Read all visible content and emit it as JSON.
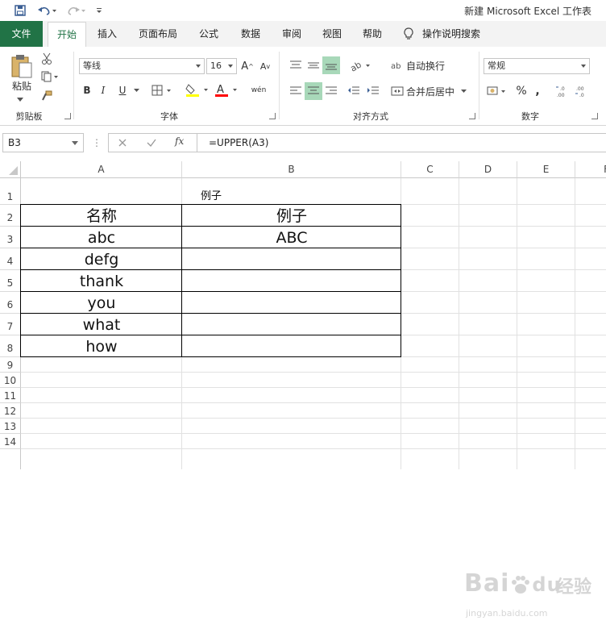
{
  "titlebar": {
    "title": "新建 Microsoft Excel 工作表",
    "save_icon": "save-icon",
    "undo_icon": "undo-icon",
    "redo_icon": "redo-icon",
    "qat_more_icon": "customize-qat-icon"
  },
  "tabs": {
    "file": "文件",
    "home": "开始",
    "insert": "插入",
    "page_layout": "页面布局",
    "formulas": "公式",
    "data": "数据",
    "review": "审阅",
    "view": "视图",
    "help": "帮助",
    "tell_me": "操作说明搜索"
  },
  "ribbon": {
    "clipboard": {
      "label": "剪贴板",
      "paste": "粘贴"
    },
    "font": {
      "label": "字体",
      "font_name": "等线",
      "font_size": "16",
      "bold": "B",
      "italic": "I",
      "underline": "U",
      "grow": "A",
      "shrink": "A",
      "phonetic": "wén"
    },
    "alignment": {
      "label": "对齐方式",
      "wrap_text": "自动换行",
      "merge_center": "合并后居中"
    },
    "number": {
      "label": "数字",
      "format": "常规",
      "percent": "%",
      "comma": ","
    }
  },
  "formula_bar": {
    "name_box": "B3",
    "formula": "=UPPER(A3)",
    "fx": "fx"
  },
  "columns": [
    "A",
    "B",
    "C",
    "D",
    "E",
    "F"
  ],
  "rows": [
    "1",
    "2",
    "3",
    "4",
    "5",
    "6",
    "7",
    "8",
    "9",
    "10",
    "11",
    "12",
    "13",
    "14"
  ],
  "cells": {
    "B1": "例子",
    "A2": "名称",
    "B2": "例子",
    "A3": "abc",
    "B3": "ABC",
    "A4": "defg",
    "A5": "thank",
    "A6": "you",
    "A7": "what",
    "A8": "how"
  },
  "watermark": {
    "brand": "Bai",
    "brand2": "du",
    "cn": "经验",
    "url": "jingyan.baidu.com"
  }
}
